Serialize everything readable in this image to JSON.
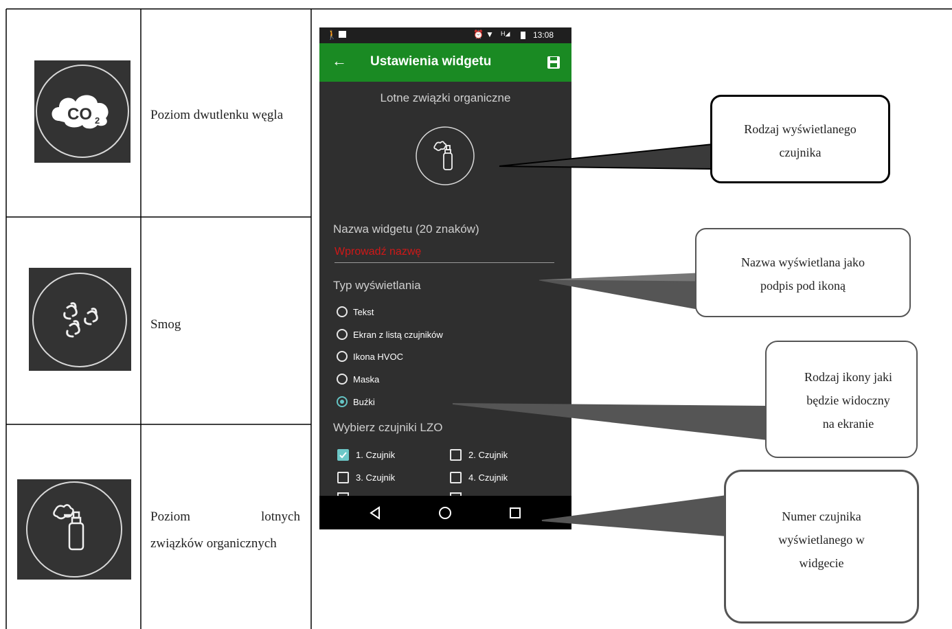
{
  "table": {
    "rows": [
      {
        "icon": "co2-cloud-icon",
        "description": "Poziom dwutlenku węgla"
      },
      {
        "icon": "smog-icon",
        "description": "Smog"
      },
      {
        "icon": "spray-can-icon",
        "description_line1": "Poziom lotnych",
        "description_line2": "związków organicznych",
        "word_left": "Poziom",
        "word_right": "lotnych"
      }
    ]
  },
  "phone": {
    "status_time": "13:08",
    "appbar_title": "Ustawienia widgetu",
    "sensor_name": "Lotne związki organiczne",
    "widget_name_label": "Nazwa widgetu (20 znaków)",
    "widget_name_placeholder": "Wprowadź nazwę",
    "display_type_label": "Typ wyświetlania",
    "display_options": [
      "Tekst",
      "Ekran z listą czujników",
      "Ikona HVOC",
      "Maska",
      "Buźki"
    ],
    "selected_option": "Buźki",
    "sensors_label": "Wybierz czujniki LZO",
    "sensors": [
      {
        "label": "1. Czujnik",
        "checked": true
      },
      {
        "label": "2. Czujnik",
        "checked": false
      },
      {
        "label": "3. Czujnik",
        "checked": false
      },
      {
        "label": "4. Czujnik",
        "checked": false
      }
    ]
  },
  "callouts": {
    "sensor_type": {
      "line1": "Rodzaj wyświetlanego",
      "line2": "czujnika"
    },
    "name": {
      "line1": "Nazwa wyświetlana jako",
      "line2": "podpis pod ikoną"
    },
    "icon_type": {
      "line1": "Rodzaj ikony jaki",
      "line2": "będzie widoczny",
      "line3": "na ekranie"
    },
    "sensor_number": {
      "line1": "Numer czujnika",
      "line2": "wyświetlanego w",
      "line3": "widgecie"
    }
  },
  "colors": {
    "appbar": "#1a8a23",
    "screen_bg": "#2f2f2f",
    "accent": "#6cc7c7",
    "placeholder": "#d01818"
  }
}
